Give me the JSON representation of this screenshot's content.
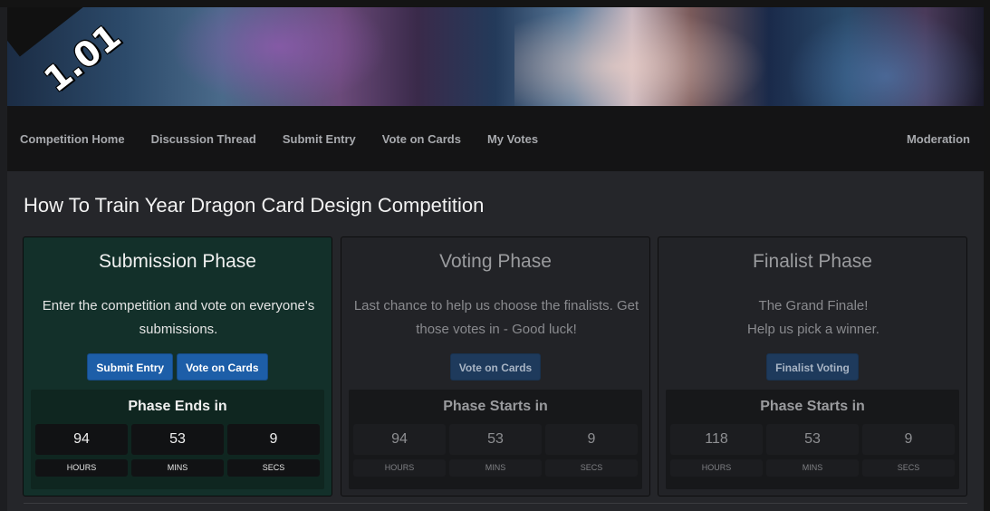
{
  "banner": {
    "version": "1.01"
  },
  "nav": {
    "items": [
      "Competition Home",
      "Discussion Thread",
      "Submit Entry",
      "Vote on Cards",
      "My Votes"
    ],
    "right_item": "Moderation"
  },
  "page_title": "How To Train Year Dragon Card Design Competition",
  "phases": [
    {
      "title": "Submission Phase",
      "desc_line1": "Enter the competition and vote on everyone's",
      "desc_line2": "submissions.",
      "buttons": [
        "Submit Entry",
        "Vote on Cards"
      ],
      "timer_label": "Phase Ends in",
      "hours": "94",
      "mins": "53",
      "secs": "9"
    },
    {
      "title": "Voting Phase",
      "desc_line1": "Last chance to help us choose the finalists. Get",
      "desc_line2": "those votes in - Good luck!",
      "buttons": [
        "Vote on Cards"
      ],
      "timer_label": "Phase Starts in",
      "hours": "94",
      "mins": "53",
      "secs": "9"
    },
    {
      "title": "Finalist Phase",
      "desc_line1": "The Grand Finale!",
      "desc_line2": "Help us pick a winner.",
      "buttons": [
        "Finalist Voting"
      ],
      "timer_label": "Phase Starts in",
      "hours": "118",
      "mins": "53",
      "secs": "9"
    }
  ],
  "units": {
    "hours": "HOURS",
    "mins": "MINS",
    "secs": "SECS"
  },
  "colors": {
    "active_card": "#13302a",
    "button": "#1d5ea8",
    "background": "#25262a"
  }
}
